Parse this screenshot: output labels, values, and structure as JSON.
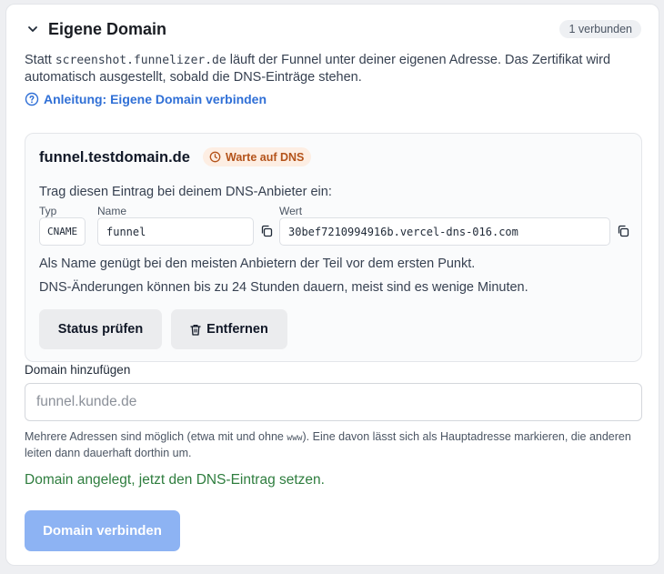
{
  "section": {
    "title": "Eigene Domain",
    "badge": "1 verbunden",
    "description_before": "Statt ",
    "description_code": "screenshot.funnelizer.de",
    "description_after": " läuft der Funnel unter deiner eigenen Adresse. Das Zertifikat wird automatisch ausgestellt, sobald die DNS-Einträge stehen.",
    "guide_link": "Anleitung: Eigene Domain verbinden"
  },
  "domain": {
    "name": "funnel.testdomain.de",
    "status": "Warte auf DNS",
    "instruction": "Trag diesen Eintrag bei deinem DNS-Anbieter ein:",
    "columns": {
      "type": "Typ",
      "name": "Name",
      "value": "Wert"
    },
    "record": {
      "type": "CNAME",
      "name": "funnel",
      "value": "30bef7210994916b.vercel-dns-016.com"
    },
    "note_name": "Als Name genügt bei den meisten Anbietern der Teil vor dem ersten Punkt.",
    "note_time": "DNS-Änderungen können bis zu 24 Stunden dauern, meist sind es wenige Minuten.",
    "check_button": "Status prüfen",
    "remove_button": "Entfernen"
  },
  "add": {
    "label": "Domain hinzufügen",
    "placeholder": "funnel.kunde.de",
    "help_before": "Mehrere Adressen sind möglich (etwa mit und ohne ",
    "help_code": "www",
    "help_after": "). Eine davon lässt sich als Hauptadresse markieren, die anderen leiten dann dauerhaft dorthin um.",
    "success": "Domain angelegt, jetzt den DNS-Eintrag setzen.",
    "submit_button": "Domain verbinden"
  },
  "colors": {
    "link": "#2f6fd6",
    "pending_bg": "#fdeee3",
    "pending_text": "#b4531a",
    "success": "#2e7d3e",
    "primary_disabled": "#8db3f3"
  },
  "icons": [
    "chevron-down-icon",
    "help-circle-icon",
    "clock-icon",
    "copy-icon",
    "trash-icon"
  ]
}
